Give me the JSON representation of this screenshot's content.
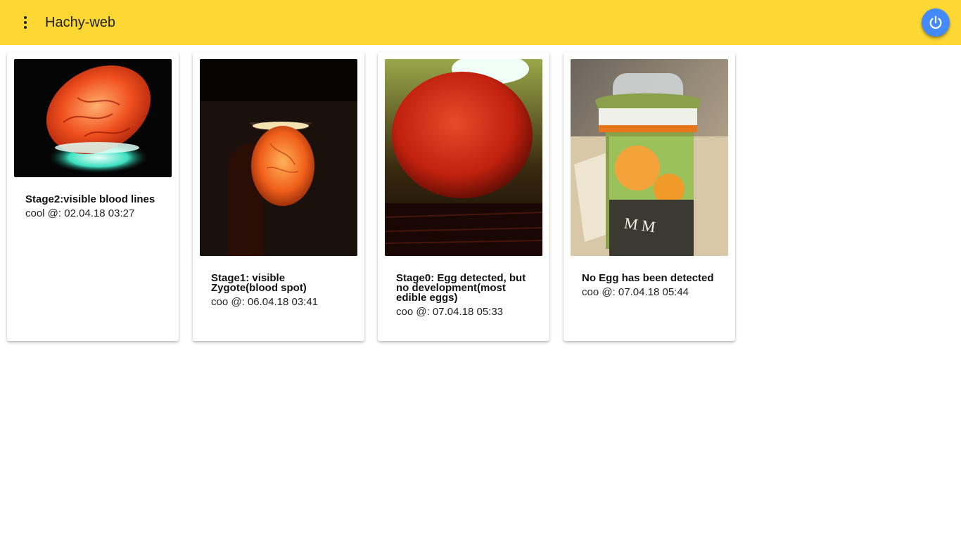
{
  "app": {
    "title": "Hachy-web",
    "accent_color": "#fdd835",
    "power_button_color": "#448aff",
    "menu_icon": "more-vert-icon",
    "power_icon": "power-icon"
  },
  "cards": [
    {
      "title": "Stage2:visible blood lines",
      "subtitle": "cool @: 02.04.18 03:27",
      "image": "candled-egg-blood-lines"
    },
    {
      "title": "Stage1: visible Zygote(blood spot)",
      "subtitle": "coo @: 06.04.18 03:41",
      "image": "candled-egg-zygote"
    },
    {
      "title": "Stage0: Egg detected, but no development(most edible eggs)",
      "subtitle": "coo @: 07.04.18 05:33",
      "image": "candled-egg-no-development"
    },
    {
      "title": "No Egg has been detected",
      "subtitle": "coo @: 07.04.18 05:44",
      "image": "juice-bottle-no-egg"
    }
  ]
}
